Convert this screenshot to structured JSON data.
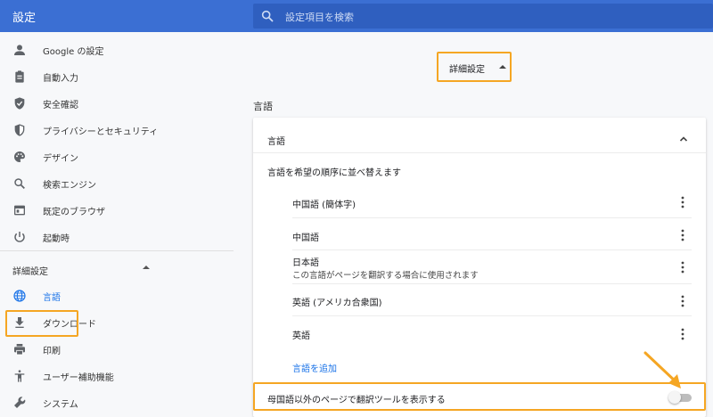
{
  "app": {
    "title": "設定"
  },
  "search": {
    "placeholder": "設定項目を検索"
  },
  "sidebar": {
    "items": [
      {
        "label": "Google の設定",
        "icon": "person-icon"
      },
      {
        "label": "自動入力",
        "icon": "clipboard-icon"
      },
      {
        "label": "安全確認",
        "icon": "shield-check-icon"
      },
      {
        "label": "プライバシーとセキュリティ",
        "icon": "shield-icon"
      },
      {
        "label": "デザイン",
        "icon": "palette-icon"
      },
      {
        "label": "検索エンジン",
        "icon": "search-icon"
      },
      {
        "label": "既定のブラウザ",
        "icon": "browser-icon"
      },
      {
        "label": "起動時",
        "icon": "power-icon"
      }
    ],
    "advanced_label": "詳細設定",
    "advanced_items": [
      {
        "label": "言語",
        "icon": "globe-icon",
        "active": true
      },
      {
        "label": "ダウンロード",
        "icon": "download-icon"
      },
      {
        "label": "印刷",
        "icon": "printer-icon"
      },
      {
        "label": "ユーザー補助機能",
        "icon": "accessibility-icon"
      },
      {
        "label": "システム",
        "icon": "wrench-icon"
      }
    ]
  },
  "main": {
    "advanced_toggle": "詳細設定",
    "section_title": "言語",
    "card": {
      "title": "言語",
      "reorder_label": "言語を希望の順序に並べ替えます",
      "languages": [
        {
          "name": "中国語 (簡体字)"
        },
        {
          "name": "中国語"
        },
        {
          "name": "日本語",
          "note": "この言語がページを翻訳する場合に使用されます"
        },
        {
          "name": "英語 (アメリカ合衆国)"
        },
        {
          "name": "英語"
        }
      ],
      "add_language": "言語を追加"
    },
    "translate_offer": {
      "label": "母国語以外のページで翻訳ツールを表示する",
      "enabled": false
    }
  },
  "colors": {
    "header": "#3b6fd3",
    "accent": "#1a73e8",
    "highlight": "#f5a623"
  }
}
